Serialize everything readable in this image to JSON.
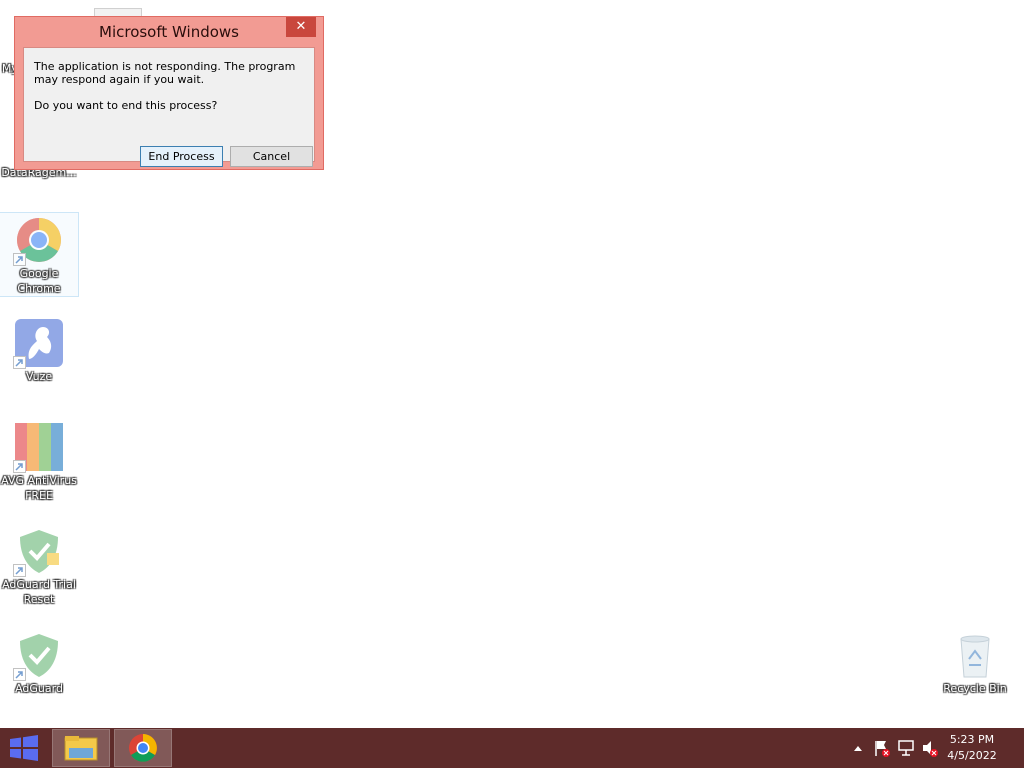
{
  "desktop": {
    "icons": [
      {
        "label": "My Computer",
        "icon": "computer-icon"
      },
      {
        "label": "DataRagem...",
        "icon": "app-icon"
      },
      {
        "label": "Google Chrome",
        "icon": "chrome-icon"
      },
      {
        "label": "Vuze",
        "icon": "vuze-icon"
      },
      {
        "label": "AVG AntiVirus FREE",
        "icon": "avg-icon"
      },
      {
        "label": "AdGuard Trial Reset",
        "icon": "adguard-trial-icon"
      },
      {
        "label": "AdGuard",
        "icon": "adguard-icon"
      },
      {
        "label": "Recycle Bin",
        "icon": "recycle-bin-icon"
      }
    ]
  },
  "dialog": {
    "title": "Microsoft Windows",
    "close_glyph": "✕",
    "message": "The application is not responding. The program may respond again if you wait.",
    "question": "Do you want to end this process?",
    "end_process_label": "End Process",
    "cancel_label": "Cancel"
  },
  "taskbar": {
    "clock_time": "5:23 PM",
    "clock_date": "4/5/2022",
    "tray_icons": [
      "chevron-up-icon",
      "action-center-flag-icon",
      "network-icon",
      "speaker-muted-icon"
    ],
    "pinned": [
      "file-explorer-icon",
      "chrome-icon"
    ]
  },
  "colors": {
    "dialog_frame": "#f29b93",
    "taskbar": "#5e2b2a",
    "close_button": "#c9473d"
  }
}
